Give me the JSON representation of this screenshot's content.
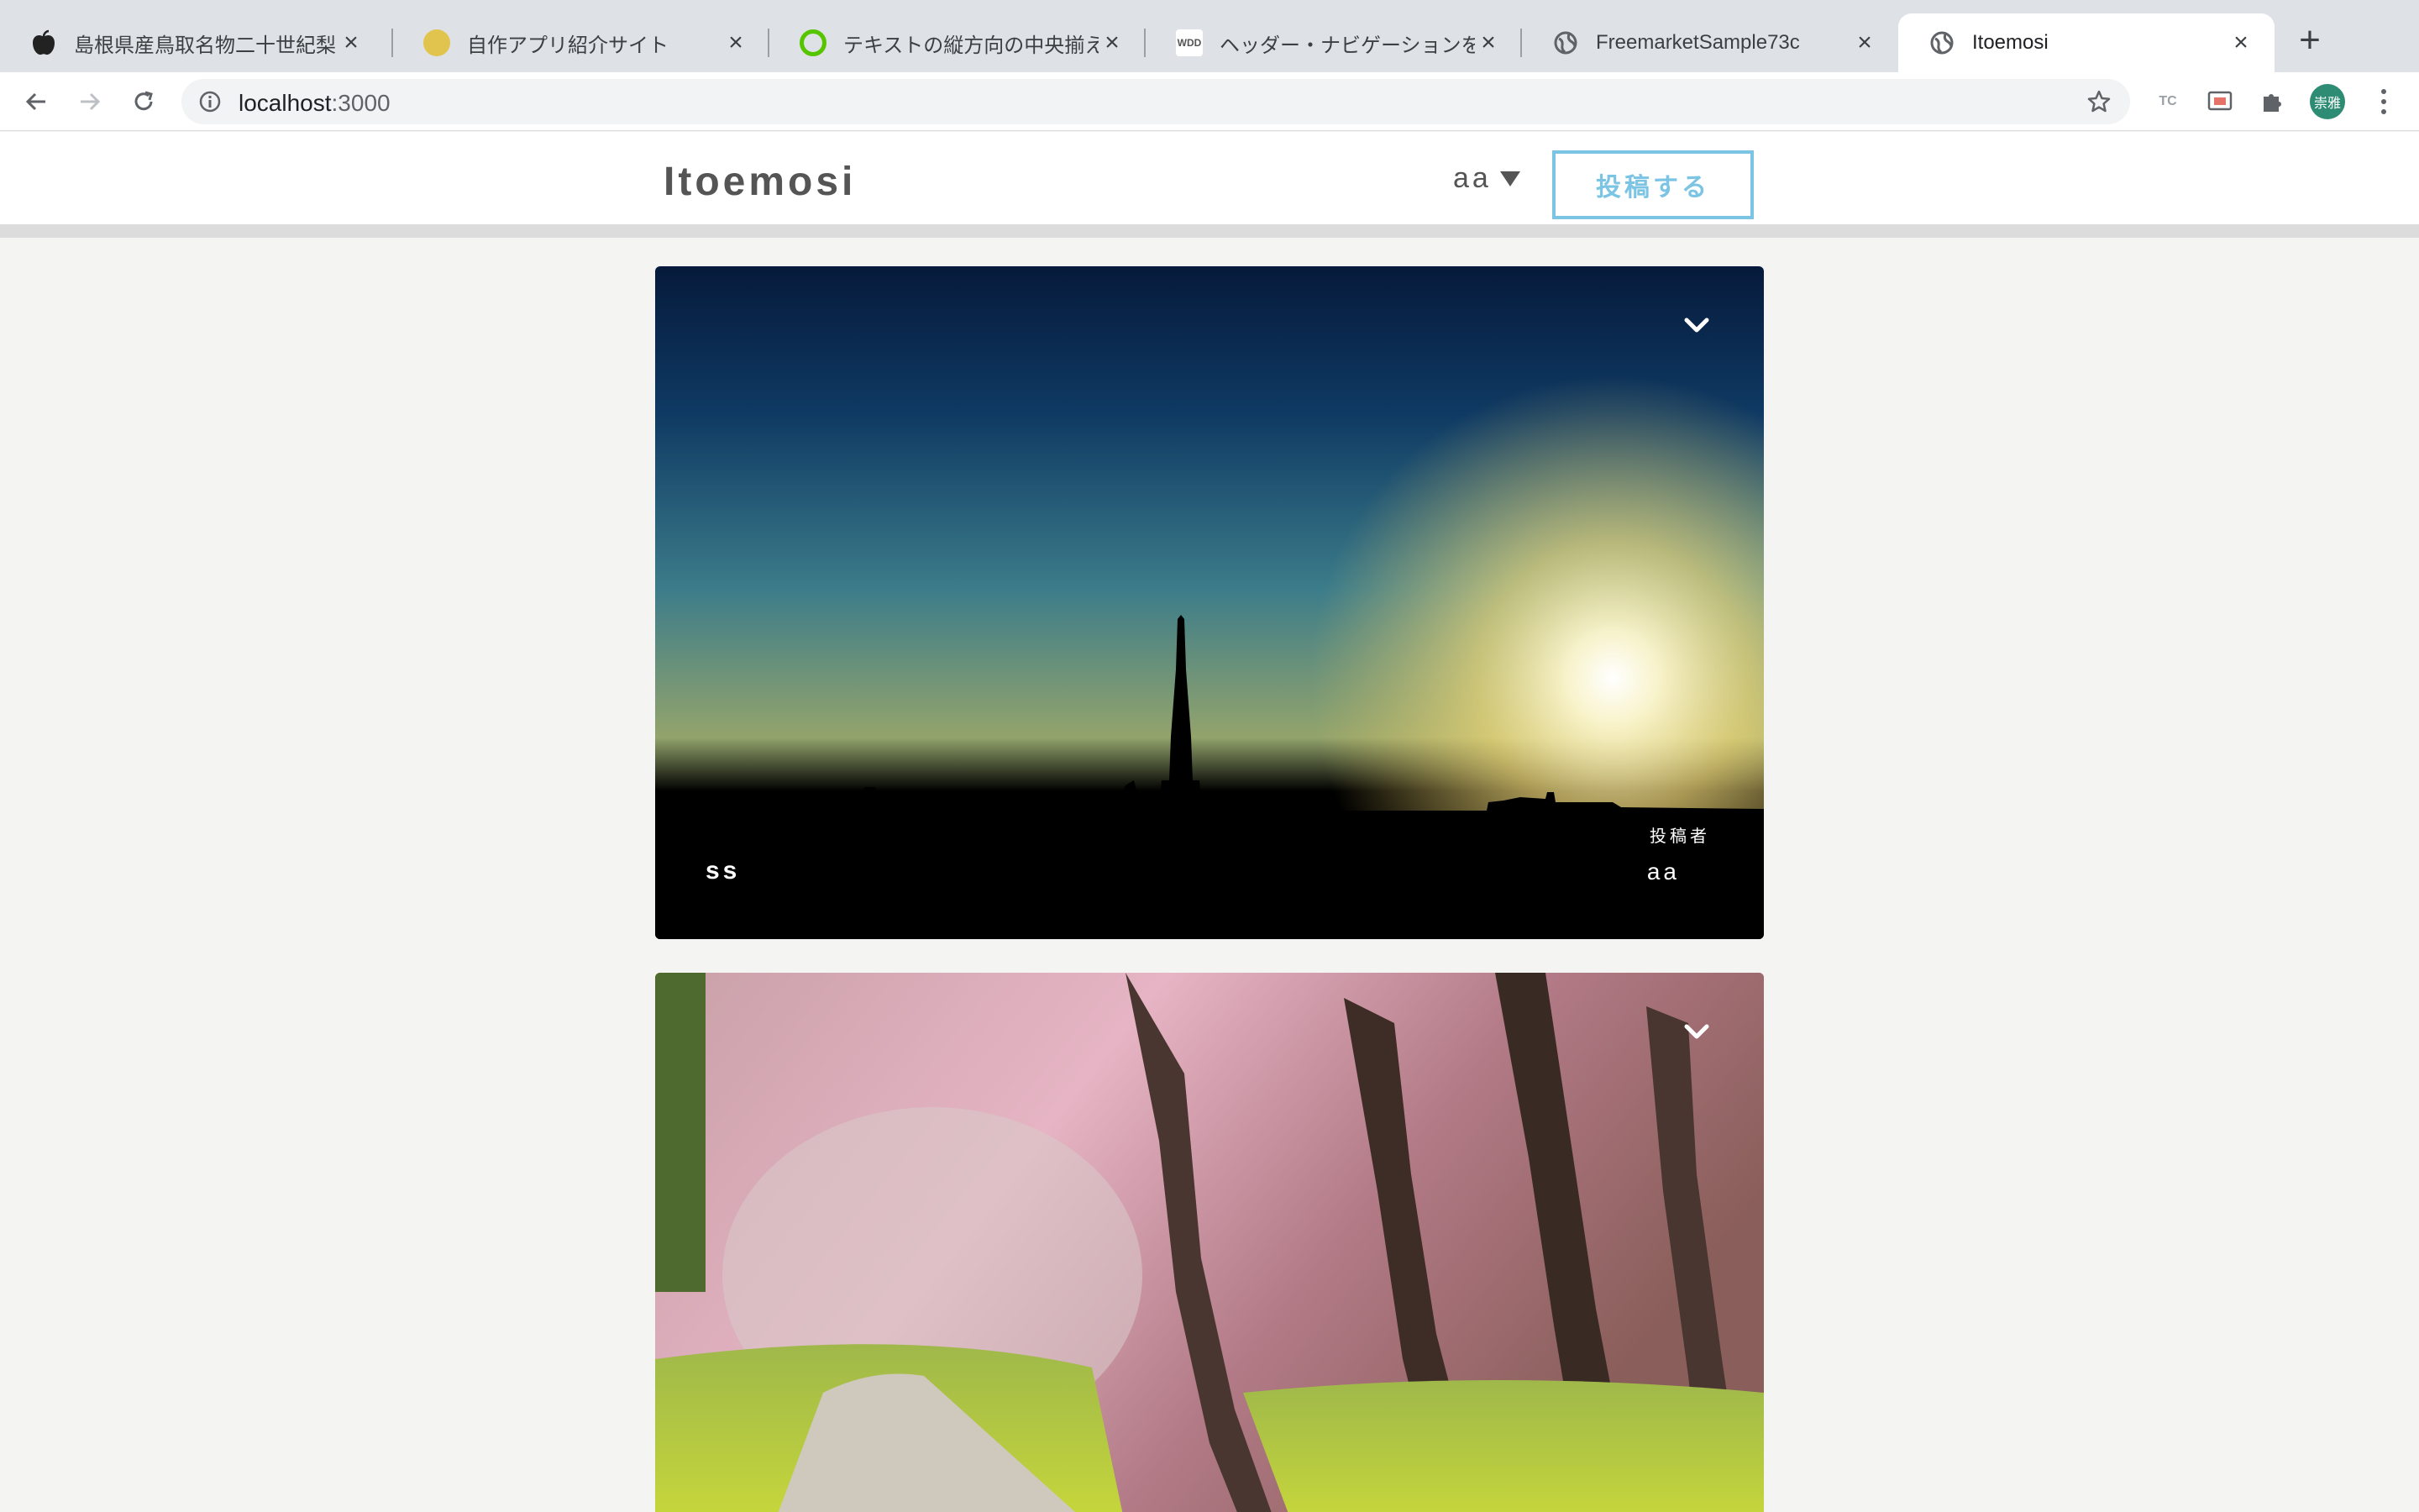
{
  "browser": {
    "tabs": [
      {
        "title": "島根県産鳥取名物二十世紀梨",
        "icon": "apple-icon"
      },
      {
        "title": "自作アプリ紹介サイト",
        "icon": "lemon-icon"
      },
      {
        "title": "テキストの縦方向の中央揃えに",
        "icon": "qiita-icon"
      },
      {
        "title": "ヘッダー・ナビゲーションを固",
        "icon": "wdd-icon"
      },
      {
        "title": "FreemarketSample73c",
        "icon": "globe-icon"
      },
      {
        "title": "Itoemosi",
        "icon": "globe-icon",
        "active": true
      }
    ],
    "url_host": "localhost",
    "url_port": ":3000",
    "ext_tc_label": "TC",
    "avatar_text": "崇雅",
    "wdd_icon_text": "WDD"
  },
  "site": {
    "logo": "Itoemosi",
    "user_name": "aa",
    "post_button": "投稿する"
  },
  "posts": [
    {
      "title": "ss",
      "poster_label": "投稿者",
      "poster_name": "aa"
    },
    {
      "title": "",
      "poster_label": "",
      "poster_name": ""
    }
  ],
  "colors": {
    "accent": "#7cc4e4",
    "header_text": "#555555",
    "page_bg": "#f4f4f2"
  }
}
